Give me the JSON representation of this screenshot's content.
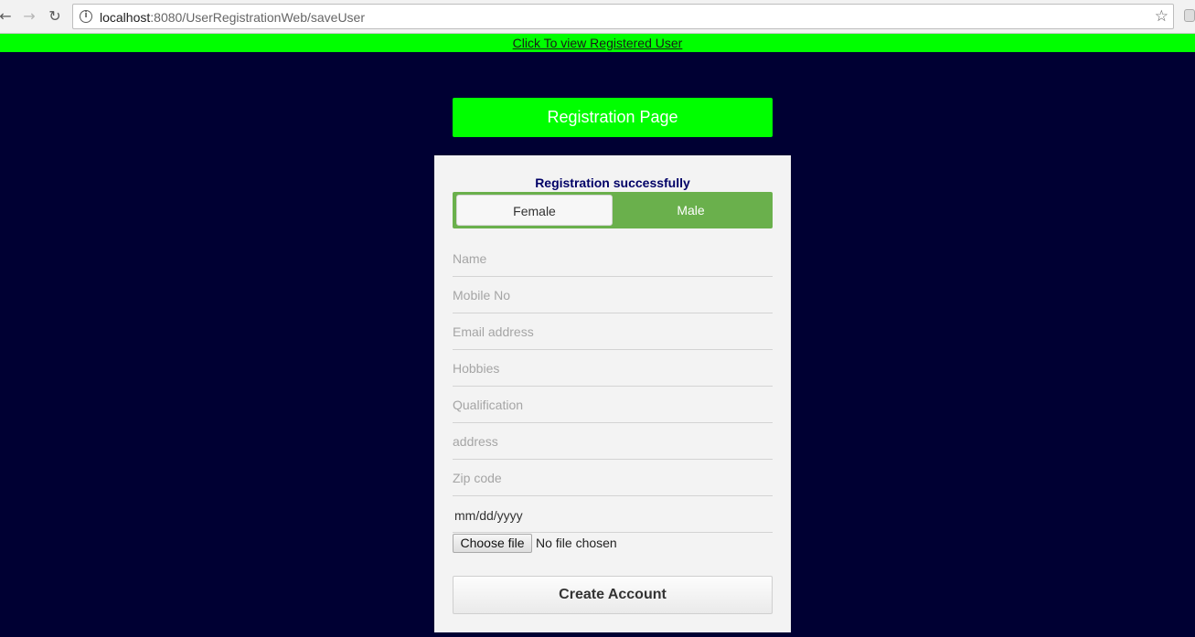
{
  "browser": {
    "url_host": "localhost",
    "url_rest": ":8080/UserRegistrationWeb/saveUser"
  },
  "top_link": "Click To view Registered User",
  "title": "Registration Page",
  "status_message": "Registration successfully",
  "gender": {
    "options": [
      "Female",
      "Male"
    ],
    "selected": "Male"
  },
  "fields": {
    "name": "Name",
    "mobile": "Mobile No",
    "email": "Email address",
    "hobbies": "Hobbies",
    "qualification": "Qualification",
    "address": "address",
    "zip": "Zip code",
    "date": "mm/dd/yyyy"
  },
  "file": {
    "button": "Choose file",
    "status": "No file chosen"
  },
  "submit_label": "Create Account",
  "colors": {
    "page_bg": "#000033",
    "accent_green": "#00ff00",
    "toggle_green": "#6ab04c",
    "status_text": "#000066"
  }
}
